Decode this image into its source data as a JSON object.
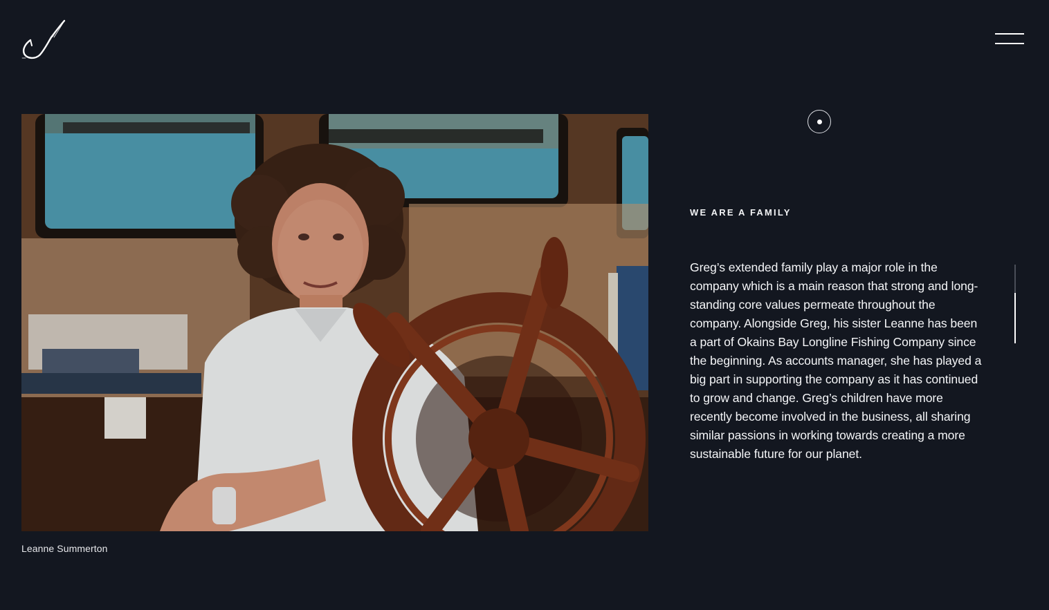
{
  "header": {
    "logo_icon": "fishing-hook-logo-icon",
    "menu_icon": "hamburger-menu-icon"
  },
  "photo": {
    "description_icon": "portrait-photo",
    "caption": "Leanne Summerton"
  },
  "section": {
    "label": "WE ARE A FAMILY",
    "body": "Greg’s extended family play a major role in the company which is a main reason that strong and long-standing core values permeate throughout the company. Alongside Greg, his sister Leanne has been a part of Okains Bay Longline Fishing Company since the beginning. As accounts manager, she has played a big part in supporting the company as it has continued to grow and change. Greg’s children have more recently become involved in the business, all sharing similar passions in working towards creating a more sustainable future for our planet."
  },
  "colors": {
    "background": "#131720",
    "text": "#ffffff",
    "track": "#4a4e58"
  }
}
